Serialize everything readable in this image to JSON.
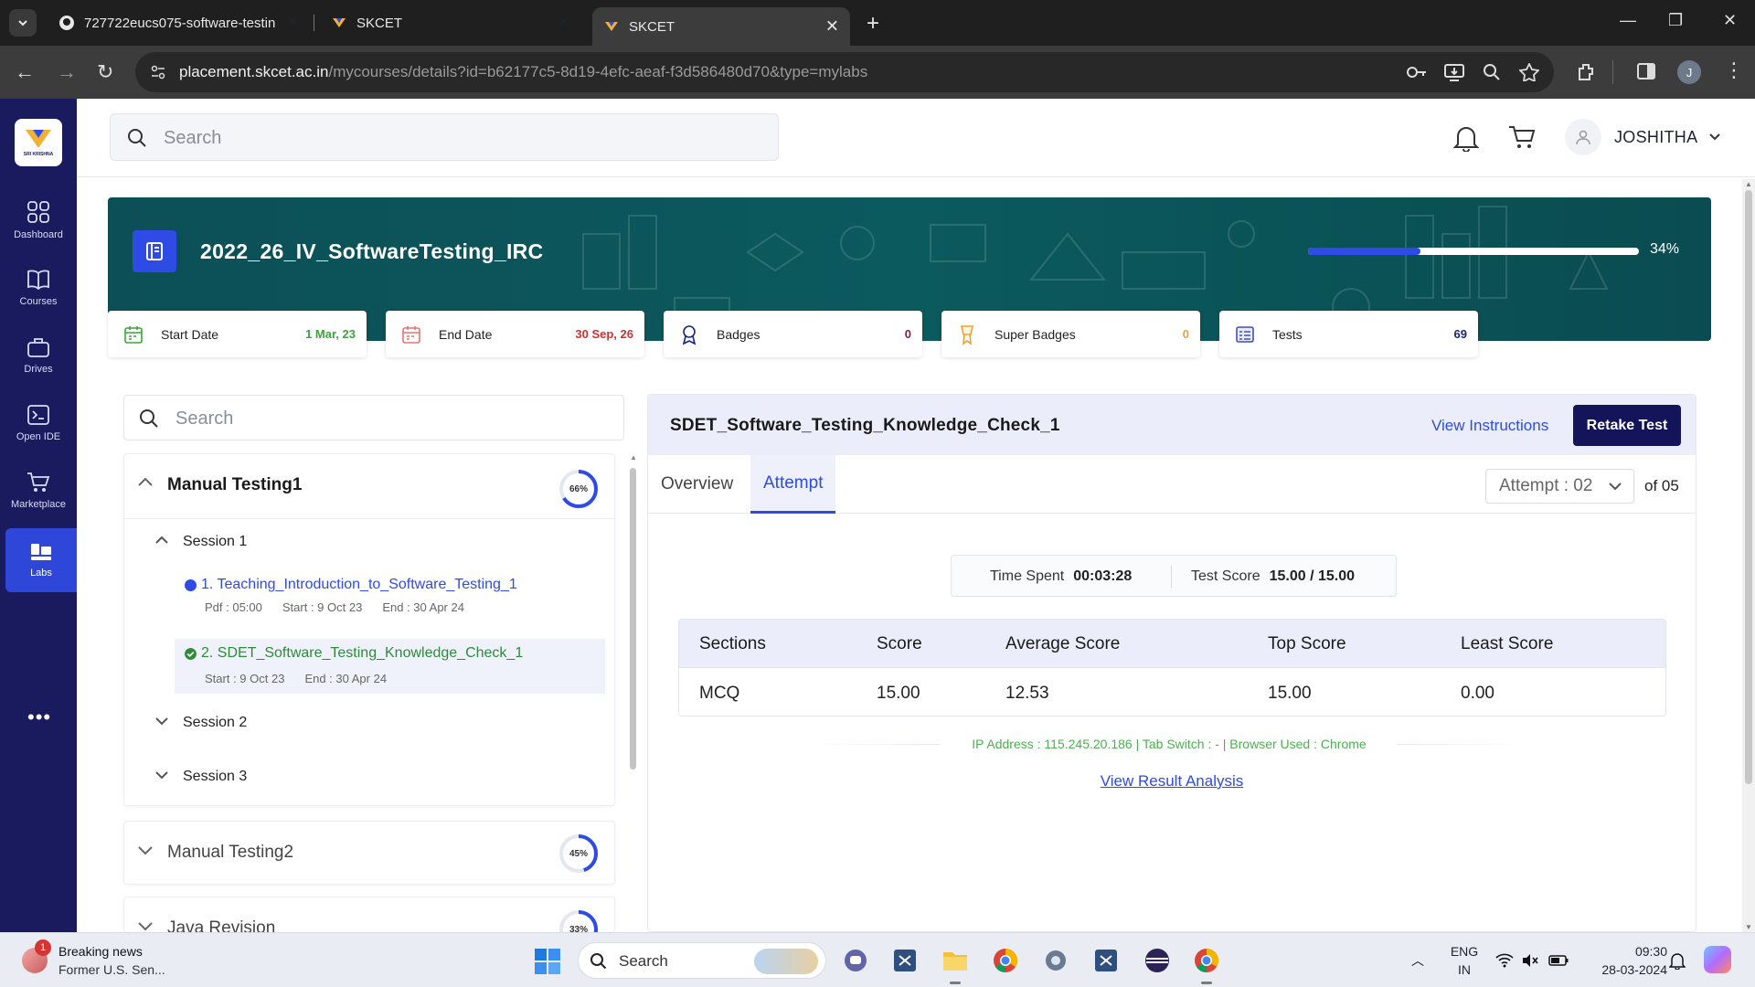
{
  "browser": {
    "tabs": [
      {
        "title": "727722eucs075-software-testin",
        "active": false
      },
      {
        "title": "SKCET",
        "active": false
      },
      {
        "title": "SKCET",
        "active": true
      }
    ],
    "url_host": "placement.skcet.ac.in",
    "url_path": "/mycourses/details?id=b62177c5-8d19-4efc-aeaf-f3d586480d70&type=mylabs",
    "profile_initial": "J"
  },
  "sidebar": {
    "logo_text": "SRI KRISHNA",
    "items": [
      {
        "label": "Dashboard",
        "icon": "grid-icon"
      },
      {
        "label": "Courses",
        "icon": "book-icon"
      },
      {
        "label": "Drives",
        "icon": "briefcase-icon"
      },
      {
        "label": "Open IDE",
        "icon": "terminal-icon"
      },
      {
        "label": "Marketplace",
        "icon": "cart-icon"
      },
      {
        "label": "Labs",
        "icon": "labs-icon",
        "active": true
      }
    ],
    "more": "•••"
  },
  "header": {
    "search_placeholder": "Search",
    "user_name": "JOSHITHA"
  },
  "course": {
    "title": "2022_26_IV_SoftwareTesting_IRC",
    "progress": 34,
    "progress_label": "34%",
    "stats": [
      {
        "label": "Start Date",
        "value": "1 Mar, 23",
        "color": "#3aa53a",
        "icon": "calendar-icon"
      },
      {
        "label": "End Date",
        "value": "30 Sep, 26",
        "color": "#d32f2f",
        "icon": "calendar-icon"
      },
      {
        "label": "Badges",
        "value": "0",
        "color": "#8a1a4a",
        "icon": "badge-icon"
      },
      {
        "label": "Super Badges",
        "value": "0",
        "color": "#f0a030",
        "icon": "super-badge-icon"
      },
      {
        "label": "Tests",
        "value": "69",
        "color": "#1a237e",
        "icon": "tests-icon"
      }
    ]
  },
  "left_panel": {
    "search_placeholder": "Search",
    "modules": [
      {
        "title": "Manual Testing1",
        "percent": 66,
        "percent_label": "66%"
      },
      {
        "title": "Manual Testing2",
        "percent": 45,
        "percent_label": "45%"
      },
      {
        "title": "Java Revision",
        "percent": 33,
        "percent_label": "33%"
      }
    ],
    "sessions": [
      "Session 1",
      "Session 2",
      "Session 3"
    ],
    "labs": [
      {
        "title": "1. Teaching_Introduction_to_Software_Testing_1",
        "meta": [
          "Pdf : 05:00",
          "Start : 9 Oct 23",
          "End : 30 Apr 24"
        ],
        "status": "in-progress",
        "color": "#2e4be6"
      },
      {
        "title": "2. SDET_Software_Testing_Knowledge_Check_1",
        "meta": [
          "Start : 9 Oct 23",
          "End : 30 Apr 24"
        ],
        "status": "completed",
        "color": "#2e8b3a"
      }
    ]
  },
  "test": {
    "title": "SDET_Software_Testing_Knowledge_Check_1",
    "view_instructions": "View Instructions",
    "retake": "Retake Test",
    "tabs": [
      "Overview",
      "Attempt"
    ],
    "active_tab": "Attempt",
    "attempt_value": "Attempt : 02",
    "attempt_of": "of 05",
    "time_spent_label": "Time Spent",
    "time_spent": "00:03:28",
    "test_score_label": "Test Score",
    "test_score": "15.00 / 15.00",
    "table": {
      "headers": [
        "Sections",
        "Score",
        "Average Score",
        "Top Score",
        "Least Score"
      ],
      "rows": [
        [
          "MCQ",
          "15.00",
          "12.53",
          "15.00",
          "0.00"
        ]
      ]
    },
    "ip_info": "IP Address : 115.245.20.186 | Tab Switch : - | Browser Used : Chrome",
    "result_link": "View Result Analysis"
  },
  "taskbar": {
    "news_badge": "1",
    "news_title": "Breaking news",
    "news_sub": "Former U.S. Sen...",
    "search_label": "Search",
    "lang_top": "ENG",
    "lang_bottom": "IN",
    "time": "09:30",
    "date": "28-03-2024"
  }
}
